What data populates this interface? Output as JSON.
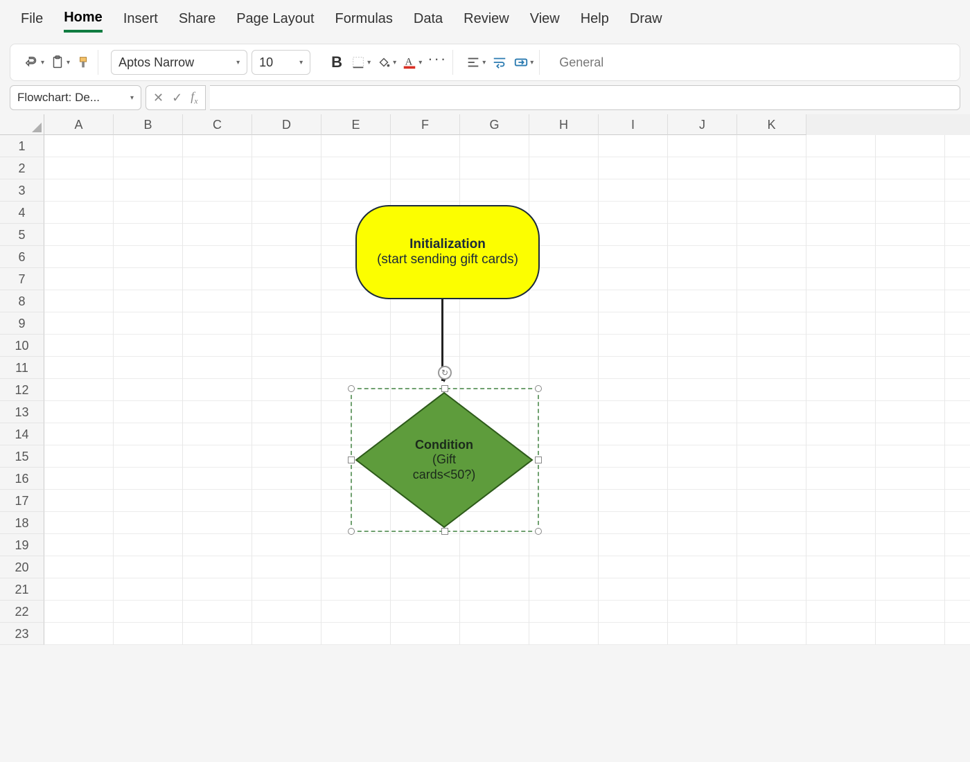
{
  "ribbon": {
    "tabs": [
      "File",
      "Home",
      "Insert",
      "Share",
      "Page Layout",
      "Formulas",
      "Data",
      "Review",
      "View",
      "Help",
      "Draw"
    ],
    "active": "Home"
  },
  "toolbar": {
    "font_name": "Aptos Narrow",
    "font_size": "10",
    "number_format": "General"
  },
  "namebox": {
    "value": "Flowchart: De..."
  },
  "formula_bar": {
    "value": ""
  },
  "grid": {
    "columns": [
      "A",
      "B",
      "C",
      "D",
      "E",
      "F",
      "G",
      "H",
      "I",
      "J",
      "K"
    ],
    "rows": [
      "1",
      "2",
      "3",
      "4",
      "5",
      "6",
      "7",
      "8",
      "9",
      "10",
      "11",
      "12",
      "13",
      "14",
      "15",
      "16",
      "17",
      "18",
      "19",
      "20",
      "21",
      "22",
      "23"
    ]
  },
  "shapes": {
    "terminator": {
      "title": "Initialization",
      "subtitle": "(start sending gift cards)"
    },
    "decision": {
      "title": "Condition",
      "line1": "(Gift",
      "line2": "cards<50?)"
    }
  },
  "icons": {
    "undo": "undo-icon",
    "clipboard": "clipboard-icon",
    "format_painter": "format-painter-icon",
    "bold": "B",
    "borders": "borders-icon",
    "fill": "fill-color-icon",
    "font_color": "font-color-icon",
    "ellipsis": "···",
    "align": "align-icon",
    "wrap": "wrap-text-icon",
    "merge": "merge-icon"
  }
}
